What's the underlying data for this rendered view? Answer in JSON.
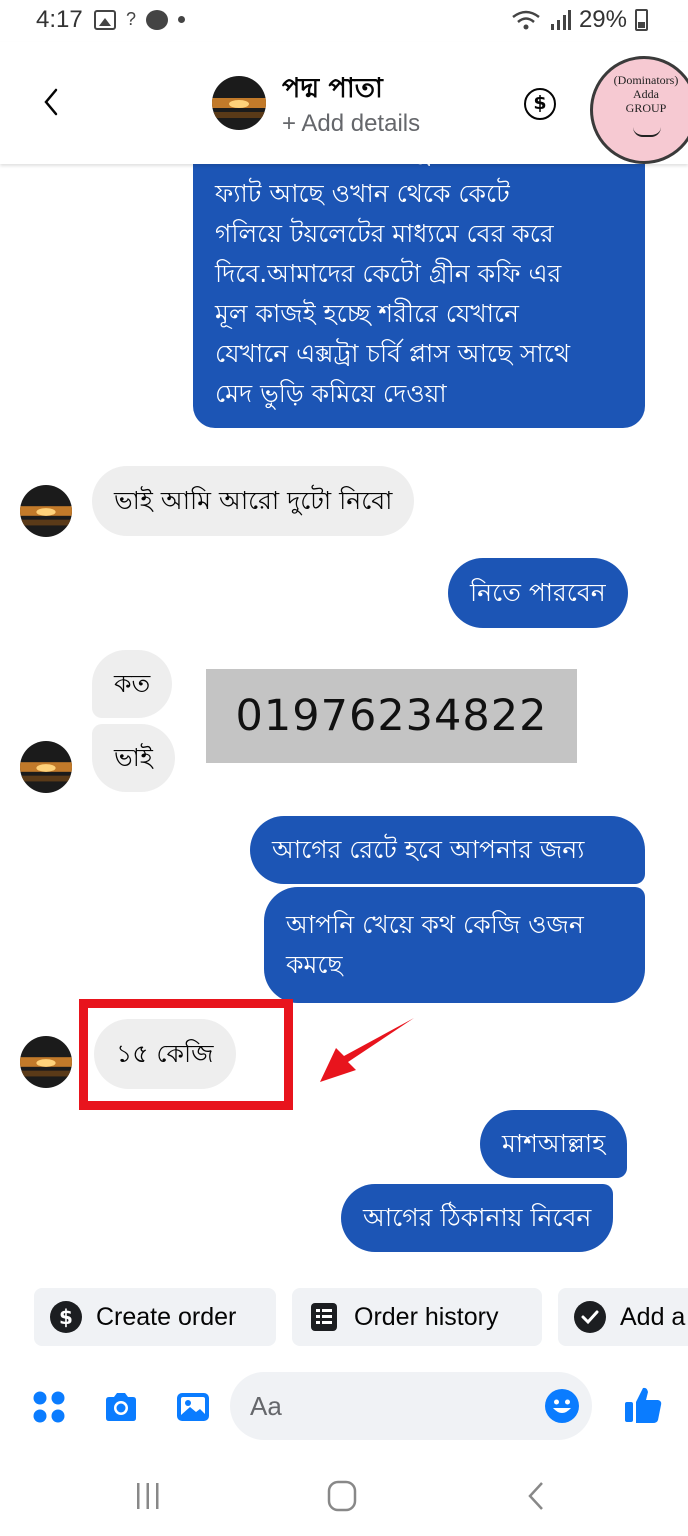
{
  "status_bar": {
    "time": "4:17",
    "signal_hint": "?",
    "battery": "29%"
  },
  "header": {
    "contact_name": "পদ্ম পাতা",
    "subtitle": "+ Add details",
    "dollar_symbol": "$",
    "group_badge": {
      "line1": "(Dominators)",
      "line2": "Adda",
      "line3": "GROUP"
    }
  },
  "messages": [
    {
      "sender": "me",
      "lines": [
        "যেখানে যেখানে এক্সট্রা চর্বি প্লাস",
        "ফ্যাট আছে ওখান থেকে কেটে",
        "গলিয়ে টয়লেটের মাধ্যমে বের করে",
        "দিবে.আমাদের কেটো গ্রীন কফি এর",
        "মূল কাজই হচ্ছে শরীরে যেখানে",
        "যেখানে এক্সট্রা চর্বি প্লাস  আছে সাথে",
        "মেদ ভুড়ি কমিয়ে দেওয়া"
      ]
    },
    {
      "sender": "them",
      "lines": [
        "ভাই আমি আরো দুটো নিবো"
      ]
    },
    {
      "sender": "me",
      "lines": [
        "নিতে পারবেন"
      ]
    },
    {
      "sender": "them",
      "lines": [
        "কত"
      ]
    },
    {
      "sender": "them",
      "lines": [
        "ভাই"
      ]
    },
    {
      "sender": "me",
      "lines": [
        "আগের রেটে হবে আপনার জন্য"
      ]
    },
    {
      "sender": "me",
      "lines": [
        "আপনি খেয়ে কথ কেজি ওজন",
        "কমছে"
      ]
    },
    {
      "sender": "them",
      "lines": [
        "১৫ কেজি"
      ]
    },
    {
      "sender": "me",
      "lines": [
        "মাশআল্লাহ"
      ]
    },
    {
      "sender": "me",
      "lines": [
        "আগের ঠিকানায় নিবেন"
      ]
    }
  ],
  "overlay": {
    "phone_number": "01976234822",
    "highlight_color": "#e8141d"
  },
  "quick_actions": [
    {
      "icon": "dollar-circle-icon",
      "label": "Create order"
    },
    {
      "icon": "receipt-icon",
      "label": "Order history"
    },
    {
      "icon": "check-circle-icon",
      "label": "Add a"
    }
  ],
  "composer": {
    "placeholder": "Aa"
  },
  "colors": {
    "outgoing_bubble": "#1c55b5",
    "incoming_bubble": "#eeeeee",
    "accent": "#0a7cff"
  }
}
